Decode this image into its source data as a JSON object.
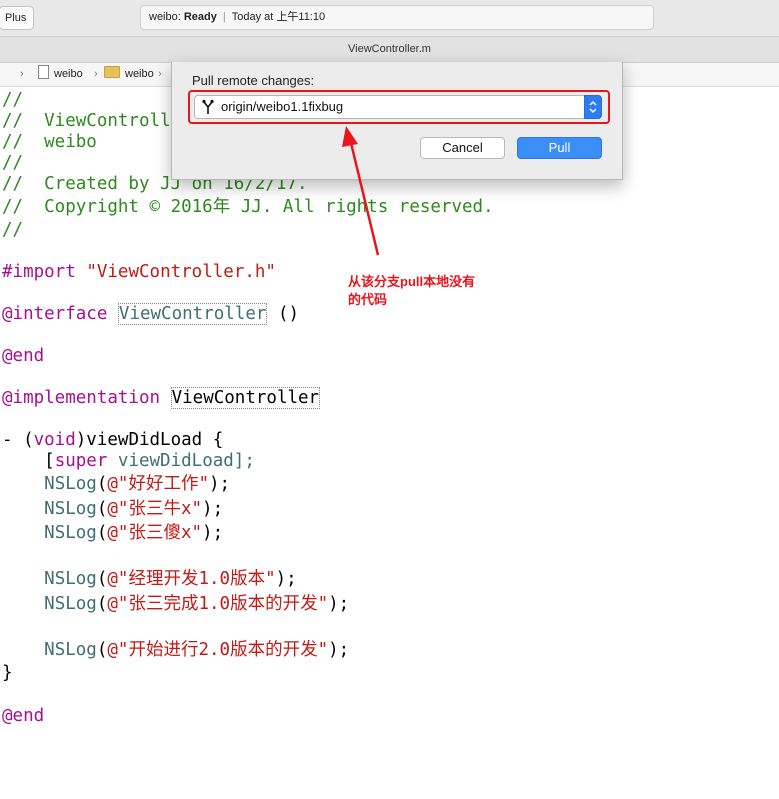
{
  "toolbar": {
    "plus_label": "Plus",
    "status_app": "weibo:",
    "status_state": "Ready",
    "status_time": "Today at 上午11:10"
  },
  "window_title": "ViewController.m",
  "jumpbar": {
    "items": [
      "weibo",
      "weibo"
    ]
  },
  "dialog": {
    "label": "Pull remote changes:",
    "branch_value": "origin/weibo1.1fixbug",
    "cancel_label": "Cancel",
    "pull_label": "Pull"
  },
  "annotation": {
    "line1": "从该分支pull本地没有",
    "line2": "的代码"
  },
  "code": {
    "c1": "//",
    "c2": "//  ViewControll",
    "c3": "//  weibo",
    "c4": "//",
    "c5": "//  Created by JJ on 16/2/17.",
    "c6": "//  Copyright © 2016年 JJ. All rights reserved.",
    "c7": "//",
    "import_kw": "#import",
    "import_str": "\"ViewController.h\"",
    "interface_kw": "@interface",
    "interface_cls": "ViewController",
    "interface_tail": " ()",
    "end1": "@end",
    "impl_kw": "@implementation",
    "impl_cls": "ViewController",
    "method_pre": "- (",
    "method_void": "void",
    "method_post": ")viewDidLoad {",
    "super_pre": "    [",
    "super_kw": "super",
    "super_post": " viewDidLoad];",
    "nslog_indent": "    ",
    "nslog_fn": "NSLog",
    "paren_open": "(",
    "paren_close": ");",
    "log1": "@\"好好工作\"",
    "log2": "@\"张三牛x\"",
    "log3": "@\"张三傻x\"",
    "log4": "@\"经理开发1.0版本\"",
    "log5": "@\"张三完成1.0版本的开发\"",
    "log6": "@\"开始进行2.0版本的开发\"",
    "close_brace": "}",
    "end2": "@end"
  }
}
